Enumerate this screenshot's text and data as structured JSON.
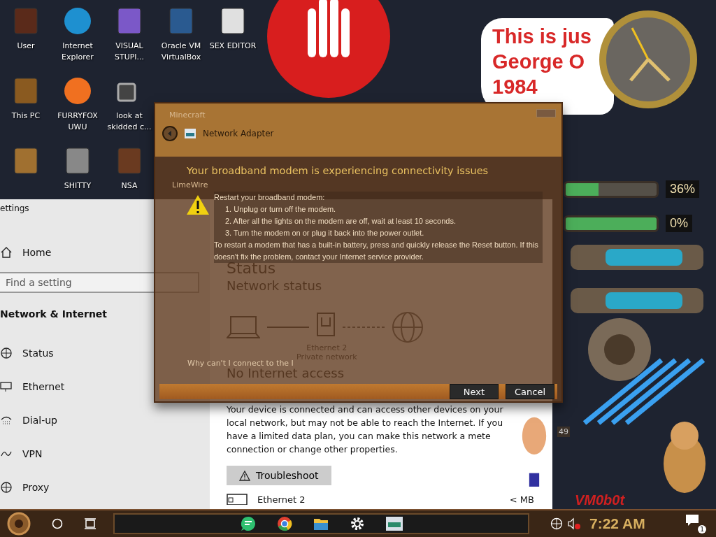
{
  "desktop_icons": [
    {
      "label": "User",
      "kind": "door"
    },
    {
      "label": "Internet Explorer",
      "kind": "wave"
    },
    {
      "label": "VISUAL STUPI...",
      "kind": "vs"
    },
    {
      "label": "Oracle VM VirtualBox",
      "kind": "cube"
    },
    {
      "label": "SEX EDITOR",
      "kind": "hex"
    },
    {
      "label": "This PC",
      "kind": "pc"
    },
    {
      "label": "FURRYFOX UWU",
      "kind": "fox"
    },
    {
      "label": "look at skidded c...",
      "kind": "copy"
    },
    {
      "kind": "none"
    },
    {
      "kind": "none"
    },
    {
      "kind": "bin"
    },
    {
      "label": "SHITTY",
      "kind": "gimp"
    },
    {
      "label": "NSA",
      "kind": "frame"
    }
  ],
  "banner": {
    "lines": [
      "This is jus",
      "George O",
      "1984"
    ]
  },
  "gauges": [
    {
      "level": 0.36,
      "reading": "36%"
    },
    {
      "level": 1,
      "reading": "0%"
    }
  ],
  "side_reading": "49",
  "overlay_label": "VM0b0t",
  "ghost_labels": [
    "Minecraft",
    "LimeWire"
  ],
  "settings": {
    "title": "ettings",
    "home": "Home",
    "search": {
      "placeholder": "Find a setting"
    },
    "section": "Network & Internet",
    "nav": [
      {
        "label": "Status",
        "kind": "status"
      },
      {
        "label": "Ethernet",
        "kind": "ethernet"
      },
      {
        "label": "Dial-up",
        "kind": "dialup"
      },
      {
        "label": "VPN",
        "kind": "vpn"
      },
      {
        "label": "Proxy",
        "kind": "proxy"
      }
    ],
    "page_title": "Status",
    "subtitle": "Network status",
    "adapter": "Ethernet 2",
    "network_type": "Private network",
    "connection_state": "No Internet access",
    "description": "Your device is connected and can access other devices on your local network, but may not be able to reach the Internet. If you have a limited data plan, you can make this network a mete",
    "description_end": "connection or change other properties.",
    "troubleshoot": "Troubleshoot",
    "usage_adapter": "Ethernet 2",
    "usage": "<  MB"
  },
  "dialog": {
    "title": "Network Adapter",
    "heading": "Your broadband modem is experiencing connectivity issues",
    "intro": "Restart your broadband modem:",
    "steps": [
      "1.  Unplug or turn off the modem.",
      "2.  After all the lights on the modem are off, wait at least 10 seconds.",
      "3.  Turn the modem on or plug it back into the power outlet."
    ],
    "note": "To restart a modem that has a built-in battery, press and quickly release the Reset button. If this doesn't fix the problem, contact your Internet service provider.",
    "help_link": "Why can't I connect to the I",
    "buttons": [
      "Next",
      "Cancel"
    ]
  },
  "taskbar": {
    "pinned": [
      {
        "kind": "chat"
      },
      {
        "kind": "browser"
      },
      {
        "kind": "folder"
      },
      {
        "kind": "settings"
      },
      {
        "kind": "adapter"
      }
    ],
    "clock": "7:22 AM",
    "notifications": "1"
  }
}
